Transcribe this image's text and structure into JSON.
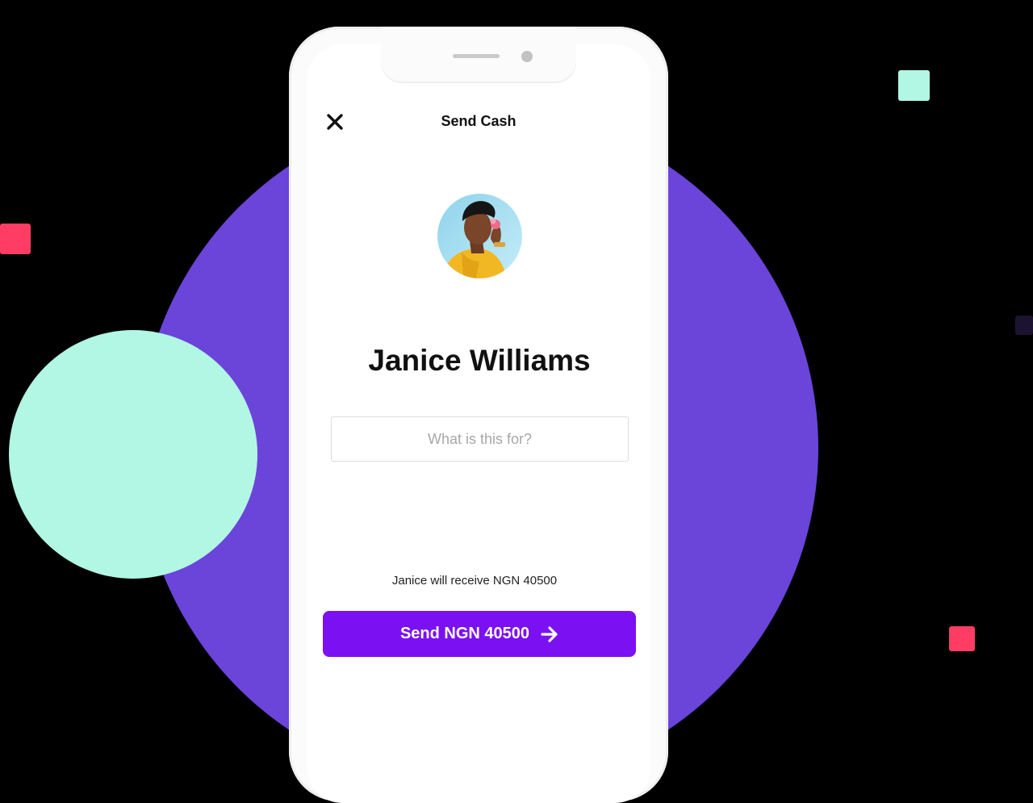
{
  "screen": {
    "title": "Send Cash"
  },
  "recipient": {
    "name": "Janice Williams"
  },
  "note_input": {
    "value": "",
    "placeholder": "What is this for?"
  },
  "summary": {
    "receive_text": "Janice will receive NGN 40500"
  },
  "send_button": {
    "label": "Send NGN 40500"
  },
  "icons": {
    "close": "close-icon",
    "send_arrow": "arrow-right-icon"
  },
  "colors": {
    "accent": "#7b10f2",
    "background_circle": "#6b44da",
    "mint": "#b1f7e3",
    "coral": "#ff3d64"
  }
}
